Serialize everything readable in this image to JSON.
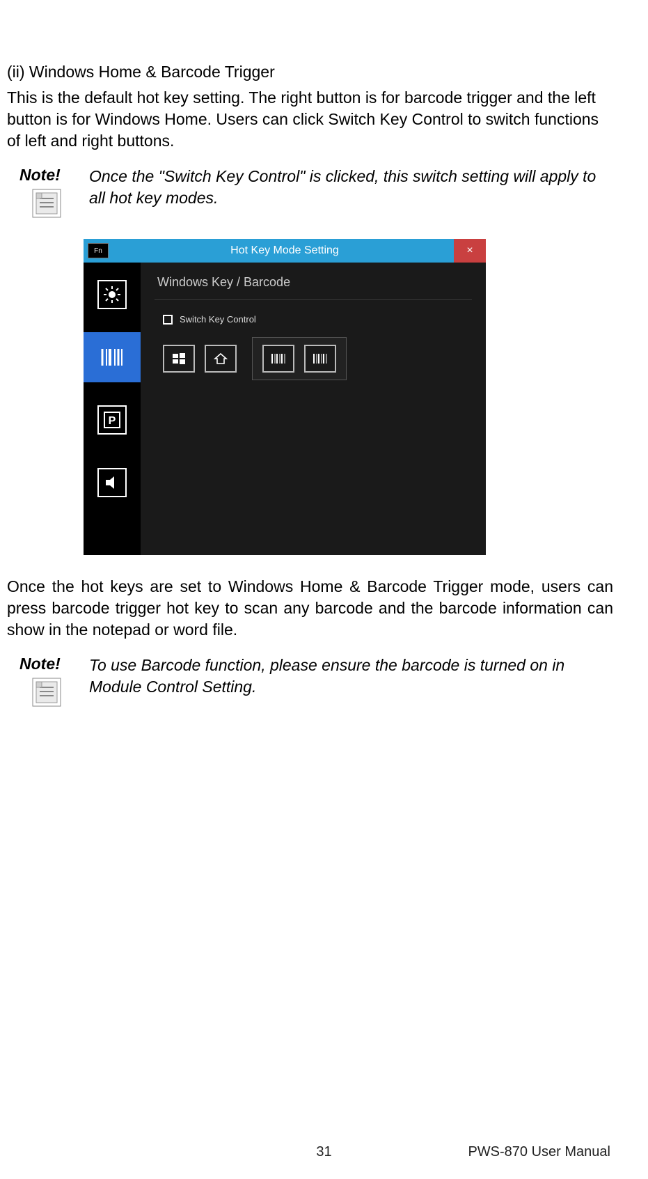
{
  "heading": "(ii) Windows Home & Barcode Trigger",
  "intro": "This is the default hot key setting. The right button is for barcode trigger and the left button is for Windows Home. Users can click Switch Key Control to switch functions of left and right buttons.",
  "note1": {
    "label": "Note!",
    "text": "Once the \"Switch Key Control\" is clicked, this switch setting will apply to all hot key modes."
  },
  "app": {
    "fn_badge": "Fn",
    "title": "Hot Key Mode Setting",
    "close_glyph": "×",
    "content_header": "Windows Key / Barcode",
    "switch_label": "Switch Key Control",
    "sidebar": {
      "items": [
        "brightness",
        "barcode",
        "parking",
        "volume"
      ],
      "selected_index": 1
    },
    "keys": {
      "left_group": [
        "windows",
        "home"
      ],
      "right_group": [
        "barcode",
        "barcode"
      ]
    }
  },
  "outro": "Once the hot keys are set to Windows Home & Barcode Trigger mode, users can press barcode trigger hot key to scan any barcode and the barcode information can show in the notepad or word file.",
  "note2": {
    "label": "Note!",
    "text": "To use Barcode function, please ensure the barcode is turned on in Module Control Setting."
  },
  "footer": {
    "page": "31",
    "doc": "PWS-870 User Manual"
  }
}
